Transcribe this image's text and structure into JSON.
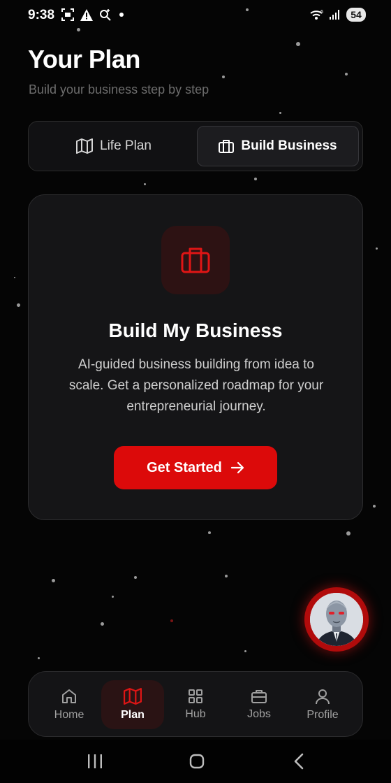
{
  "status_bar": {
    "time": "9:38",
    "battery": "54",
    "wifi_label": "6"
  },
  "header": {
    "title": "Your Plan",
    "subtitle": "Build your business step by step"
  },
  "tabs": [
    {
      "label": "Life Plan",
      "icon": "map-icon",
      "selected": false
    },
    {
      "label": "Build Business",
      "icon": "briefcase-icon",
      "selected": true
    }
  ],
  "card": {
    "icon": "briefcase-icon",
    "title": "Build My Business",
    "description": "AI-guided business building from idea to scale. Get a personalized roadmap for your entrepreneurial journey.",
    "cta_label": "Get Started"
  },
  "nav": [
    {
      "label": "Home",
      "icon": "home-icon",
      "active": false
    },
    {
      "label": "Plan",
      "icon": "map-icon",
      "active": true
    },
    {
      "label": "Hub",
      "icon": "grid-icon",
      "active": false
    },
    {
      "label": "Jobs",
      "icon": "briefcase-icon",
      "active": false
    },
    {
      "label": "Profile",
      "icon": "user-icon",
      "active": false
    }
  ],
  "colors": {
    "accent": "#dc0a0a",
    "background": "#050505",
    "card": "#151517",
    "muted_text": "#6d6d6d"
  }
}
